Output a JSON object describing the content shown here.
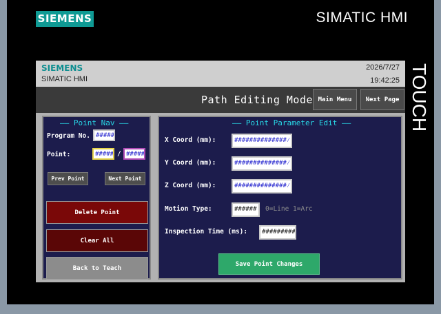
{
  "device": {
    "brand": "SIEMENS",
    "model": "SIMATIC HMI",
    "touch_label": "TOUCH"
  },
  "header": {
    "brand": "SIEMENS",
    "product": "SIMATIC HMI",
    "date": "2026/7/27",
    "time": "19:42:25"
  },
  "titlebar": {
    "title": "Path Editing Mode",
    "main_menu_label": "Main Menu",
    "next_page_label": "Next Page"
  },
  "point_nav": {
    "title": "—— Point Nav ——",
    "program_label": "Program No.",
    "program_value": "#####",
    "point_label": "Point:",
    "point_value": "#####",
    "separator": "/",
    "point_total": "#####",
    "prev_label": "Prev Point",
    "next_label": "Next Point",
    "delete_label": "Delete Point",
    "clear_label": "Clear All",
    "back_label": "Back to Teach"
  },
  "point_params": {
    "title": "—— Point Parameter Edit ——",
    "x_label": "X Coord (mm):",
    "x_value": "##############⁄",
    "y_label": "Y Coord (mm):",
    "y_value": "##############⁄",
    "z_label": "Z Coord (mm):",
    "z_value": "##############⁄",
    "motion_label": "Motion Type:",
    "motion_value": "######",
    "motion_hint": "0=Line 1=Arc",
    "inspection_label": "Inspection Time (ms):",
    "inspection_value": "#########",
    "save_label": "Save Point Changes"
  },
  "colors": {
    "panel_bg": "#1c1c4c",
    "title_cyan": "#28d7e6",
    "delete_red": "#7a0808",
    "clear_red": "#5a0606",
    "back_gray": "#8c8c8c",
    "save_green": "#2ea86a",
    "brand_teal": "#0f9a94"
  }
}
